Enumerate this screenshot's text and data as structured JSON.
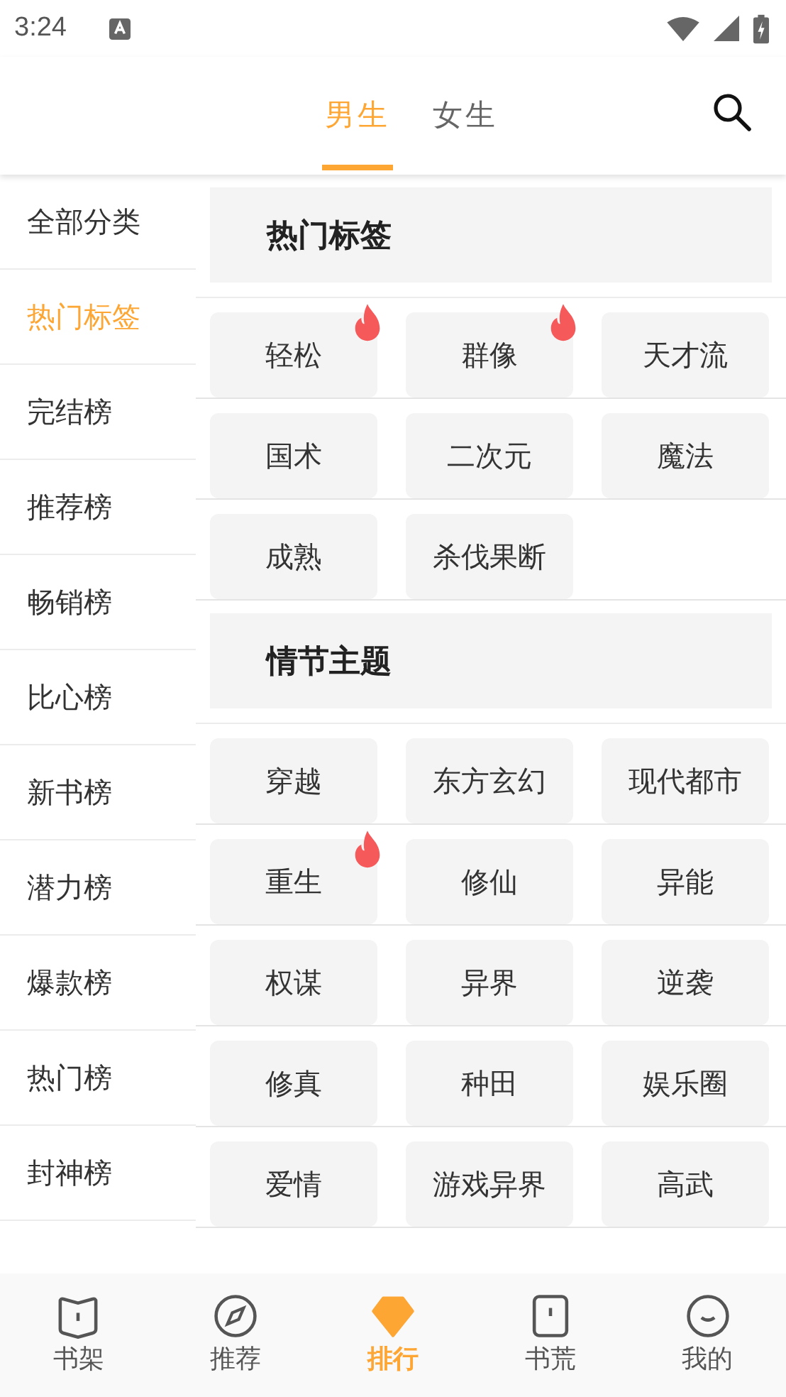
{
  "status_bar": {
    "time": "3:24"
  },
  "header": {
    "tabs": [
      {
        "label": "男生",
        "selected": true
      },
      {
        "label": "女生",
        "selected": false
      }
    ]
  },
  "sidebar": {
    "items": [
      {
        "label": "全部分类",
        "selected": false
      },
      {
        "label": "热门标签",
        "selected": true
      },
      {
        "label": "完结榜",
        "selected": false
      },
      {
        "label": "推荐榜",
        "selected": false
      },
      {
        "label": "畅销榜",
        "selected": false
      },
      {
        "label": "比心榜",
        "selected": false
      },
      {
        "label": "新书榜",
        "selected": false
      },
      {
        "label": "潜力榜",
        "selected": false
      },
      {
        "label": "爆款榜",
        "selected": false
      },
      {
        "label": "热门榜",
        "selected": false
      },
      {
        "label": "封神榜",
        "selected": false
      }
    ]
  },
  "sections": [
    {
      "title": "热门标签",
      "tags": [
        {
          "label": "轻松",
          "hot": true
        },
        {
          "label": "群像",
          "hot": true
        },
        {
          "label": "天才流",
          "hot": false
        },
        {
          "label": "国术",
          "hot": false
        },
        {
          "label": "二次元",
          "hot": false
        },
        {
          "label": "魔法",
          "hot": false
        },
        {
          "label": "成熟",
          "hot": false
        },
        {
          "label": "杀伐果断",
          "hot": false
        }
      ]
    },
    {
      "title": "情节主题",
      "tags": [
        {
          "label": "穿越",
          "hot": false
        },
        {
          "label": "东方玄幻",
          "hot": false
        },
        {
          "label": "现代都市",
          "hot": false
        },
        {
          "label": "重生",
          "hot": true
        },
        {
          "label": "修仙",
          "hot": false
        },
        {
          "label": "异能",
          "hot": false
        },
        {
          "label": "权谋",
          "hot": false
        },
        {
          "label": "异界",
          "hot": false
        },
        {
          "label": "逆袭",
          "hot": false
        },
        {
          "label": "修真",
          "hot": false
        },
        {
          "label": "种田",
          "hot": false
        },
        {
          "label": "娱乐圈",
          "hot": false
        },
        {
          "label": "爱情",
          "hot": false
        },
        {
          "label": "游戏异界",
          "hot": false
        },
        {
          "label": "高武",
          "hot": false
        }
      ]
    }
  ],
  "bottom_nav": [
    {
      "label": "书架",
      "kind": "book",
      "selected": false
    },
    {
      "label": "推荐",
      "kind": "compass",
      "selected": false
    },
    {
      "label": "排行",
      "kind": "gem",
      "selected": true
    },
    {
      "label": "书荒",
      "kind": "card",
      "selected": false
    },
    {
      "label": "我的",
      "kind": "smile",
      "selected": false
    }
  ]
}
